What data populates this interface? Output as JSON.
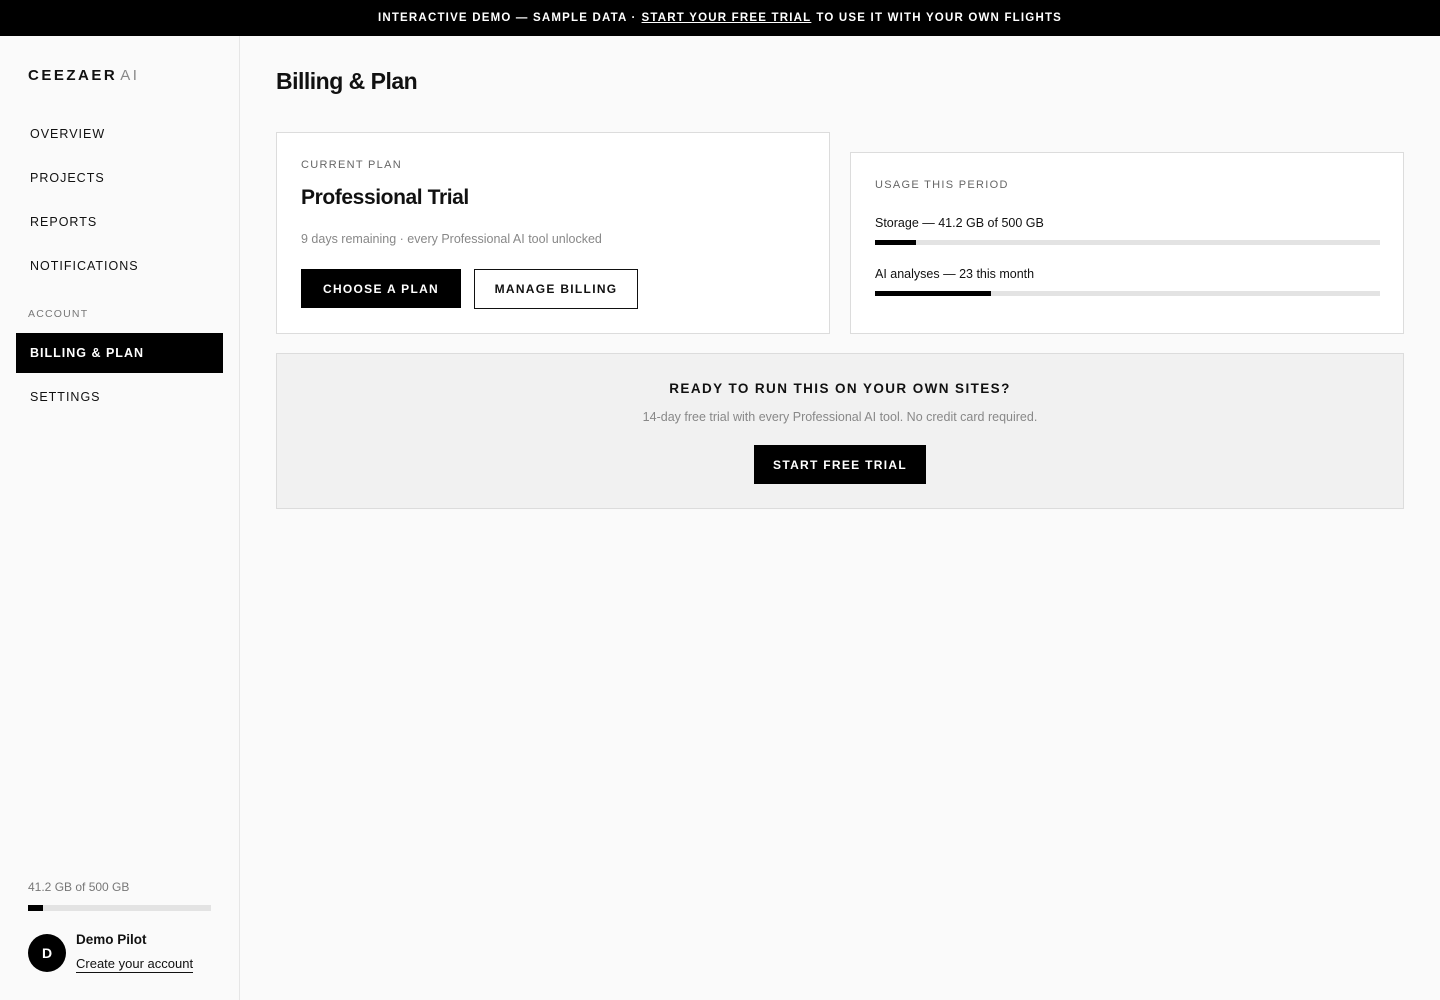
{
  "banner": {
    "lead": "INTERACTIVE DEMO — SAMPLE DATA ·",
    "link": "START YOUR FREE TRIAL",
    "tail": "TO USE IT WITH YOUR OWN FLIGHTS"
  },
  "brand": {
    "name": "CEEZAER",
    "suffix": "AI"
  },
  "sidebar": {
    "items": [
      {
        "label": "OVERVIEW"
      },
      {
        "label": "PROJECTS"
      },
      {
        "label": "REPORTS"
      },
      {
        "label": "NOTIFICATIONS"
      }
    ],
    "section_label": "ACCOUNT",
    "account_items": [
      {
        "label": "BILLING & PLAN",
        "active": true
      },
      {
        "label": "SETTINGS"
      }
    ],
    "storage_text": "41.2 GB of 500 GB",
    "storage_fraction": 0.082
  },
  "user": {
    "initial": "D",
    "name": "Demo Pilot",
    "link": "Create your account"
  },
  "page": {
    "title": "Billing & Plan"
  },
  "plan_card": {
    "eyebrow": "CURRENT PLAN",
    "name": "Professional Trial",
    "subtitle": "9 days remaining · every Professional AI tool unlocked",
    "primary_button": "CHOOSE A PLAN",
    "secondary_button": "MANAGE BILLING"
  },
  "usage_card": {
    "eyebrow": "USAGE THIS PERIOD",
    "storage_label": "Storage — 41.2 GB of 500 GB",
    "storage_fraction": 0.082,
    "analyses_label": "AI analyses — 23 this month",
    "analyses_fraction": 0.23
  },
  "cta": {
    "title": "READY TO RUN THIS ON YOUR OWN SITES?",
    "subtitle": "14-day free trial with every Professional AI tool. No credit card required.",
    "button": "START FREE TRIAL"
  }
}
